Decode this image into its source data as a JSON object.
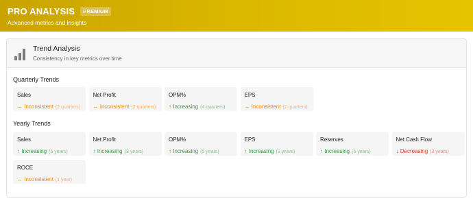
{
  "header": {
    "title": "PRO ANALYSIS",
    "badge": "PREMIUM",
    "subtitle": "Advanced metrics and insights",
    "colors": {
      "gradient_start": "#c9a400",
      "gradient_end": "#e6c400"
    }
  },
  "card": {
    "icon": "bar-chart-icon",
    "title": "Trend Analysis",
    "subtitle": "Consistency in key metrics over time"
  },
  "quarterly": {
    "title": "Quarterly Trends",
    "items": [
      {
        "name": "Sales",
        "status": "↔ Inconsistent",
        "duration": "(2 quarters)",
        "tone": "orange"
      },
      {
        "name": "Net Profit",
        "status": "↔ Inconsistent",
        "duration": "(2 quarters)",
        "tone": "orange"
      },
      {
        "name": "OPM%",
        "status": "↑ Increasing",
        "duration": "(4 quarters)",
        "tone": "green"
      },
      {
        "name": "EPS",
        "status": "↔ Inconsistent",
        "duration": "(2 quarters)",
        "tone": "orange"
      }
    ]
  },
  "yearly": {
    "title": "Yearly Trends",
    "items": [
      {
        "name": "Sales",
        "status": "↑ Increasing",
        "duration": "(6 years)",
        "tone": "green"
      },
      {
        "name": "Net Profit",
        "status": "↑ Increasing",
        "duration": "(3 years)",
        "tone": "green"
      },
      {
        "name": "OPM%",
        "status": "↑ Increasing",
        "duration": "(5 years)",
        "tone": "green"
      },
      {
        "name": "EPS",
        "status": "↑ Increasing",
        "duration": "(3 years)",
        "tone": "green"
      },
      {
        "name": "Reserves",
        "status": "↑ Increasing",
        "duration": "(6 years)",
        "tone": "green"
      },
      {
        "name": "Net Cash Flow",
        "status": "↓ Decreasing",
        "duration": "(3 years)",
        "tone": "red"
      },
      {
        "name": "ROCE",
        "status": "↔ Inconsistent",
        "duration": "(1 year)",
        "tone": "orange"
      }
    ]
  },
  "tone_colors": {
    "orange": "#f08a00",
    "green": "#3a9a43",
    "red": "#e03a2c"
  }
}
